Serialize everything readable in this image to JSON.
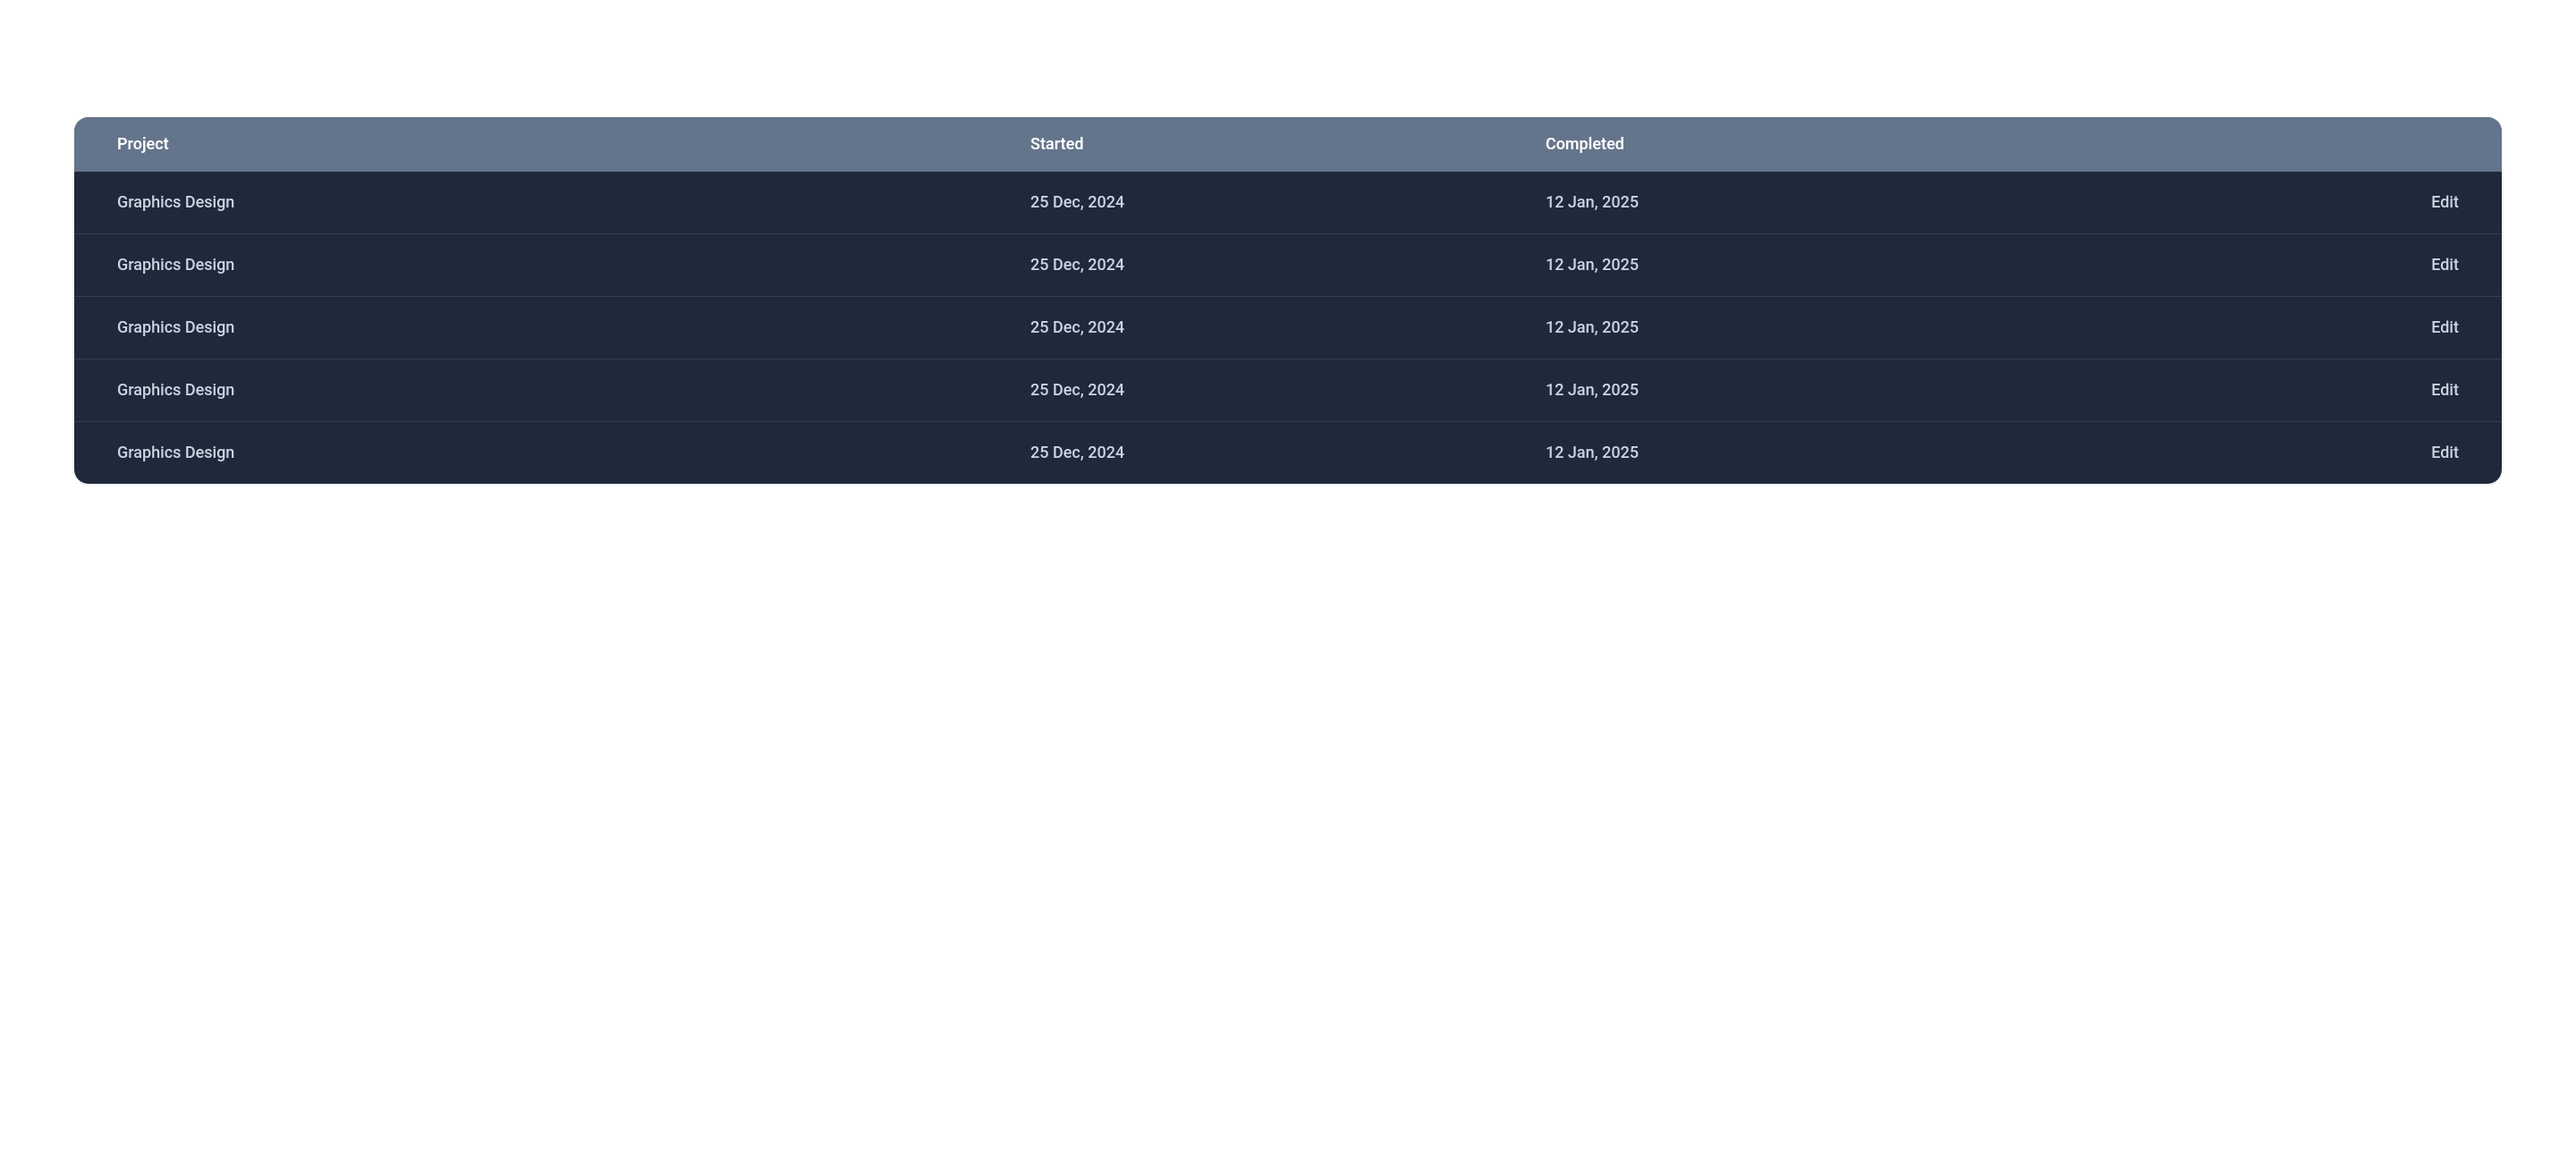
{
  "table": {
    "headers": {
      "project": "Project",
      "started": "Started",
      "completed": "Completed"
    },
    "rows": [
      {
        "project": "Graphics Design",
        "started": "25 Dec, 2024",
        "completed": "12 Jan, 2025",
        "action": "Edit"
      },
      {
        "project": "Graphics Design",
        "started": "25 Dec, 2024",
        "completed": "12 Jan, 2025",
        "action": "Edit"
      },
      {
        "project": "Graphics Design",
        "started": "25 Dec, 2024",
        "completed": "12 Jan, 2025",
        "action": "Edit"
      },
      {
        "project": "Graphics Design",
        "started": "25 Dec, 2024",
        "completed": "12 Jan, 2025",
        "action": "Edit"
      },
      {
        "project": "Graphics Design",
        "started": "25 Dec, 2024",
        "completed": "12 Jan, 2025",
        "action": "Edit"
      }
    ]
  }
}
